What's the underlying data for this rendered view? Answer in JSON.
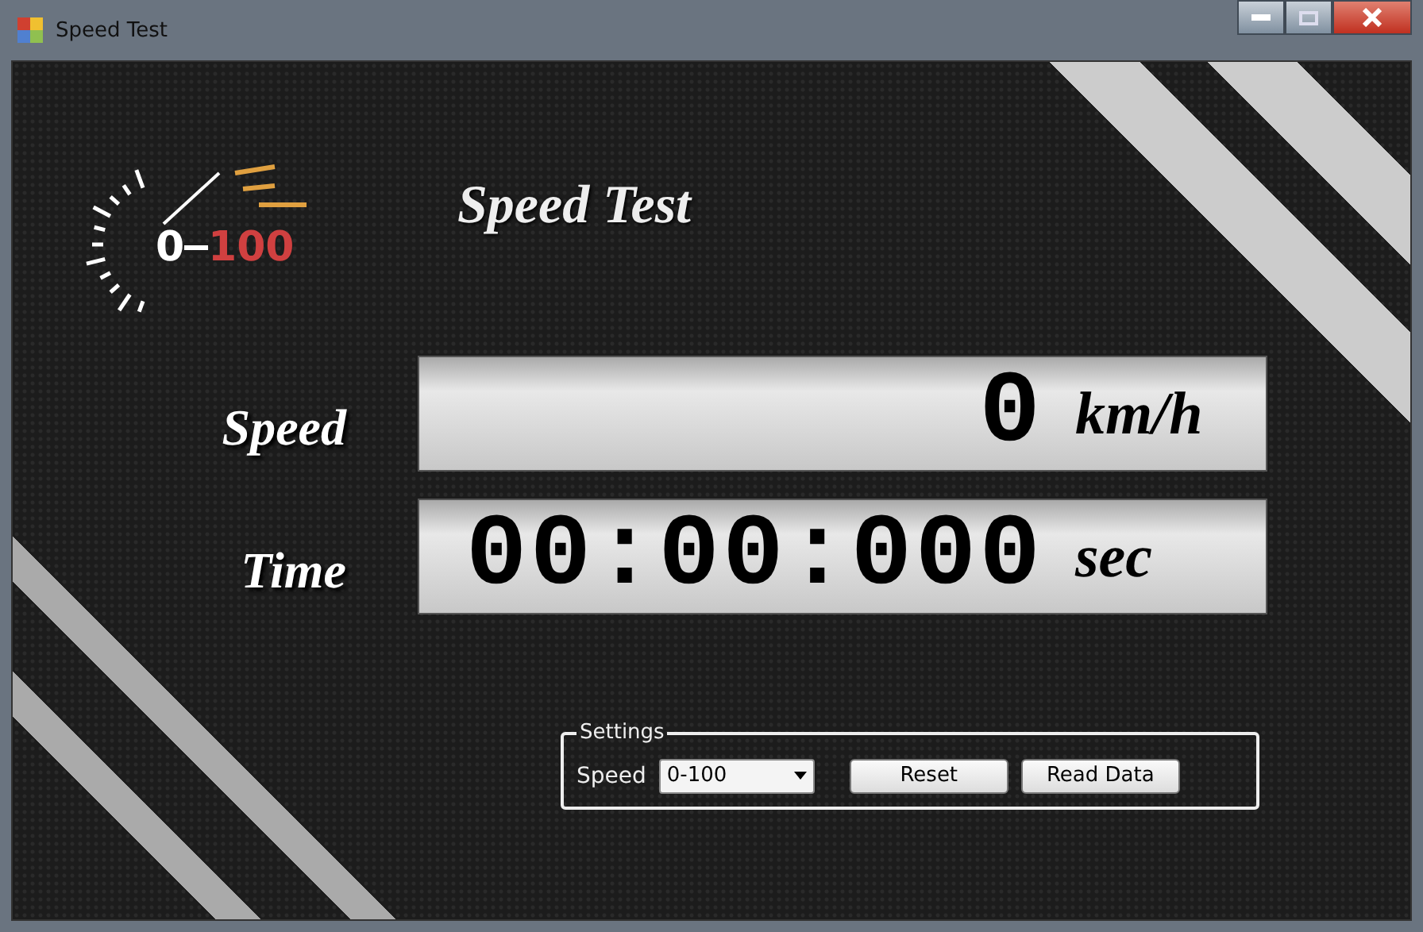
{
  "window": {
    "title": "Speed Test"
  },
  "logo": {
    "low": "0",
    "high": "100"
  },
  "heading": "Speed Test",
  "readouts": [
    {
      "label": "Speed",
      "value": "0",
      "unit": "km/h"
    },
    {
      "label": "Time",
      "value": "00:00:000",
      "unit": "sec"
    }
  ],
  "settings": {
    "title": "Settings",
    "speed_label": "Speed",
    "speed_value": "0-100",
    "buttons": [
      "Reset",
      "Read Data"
    ]
  }
}
